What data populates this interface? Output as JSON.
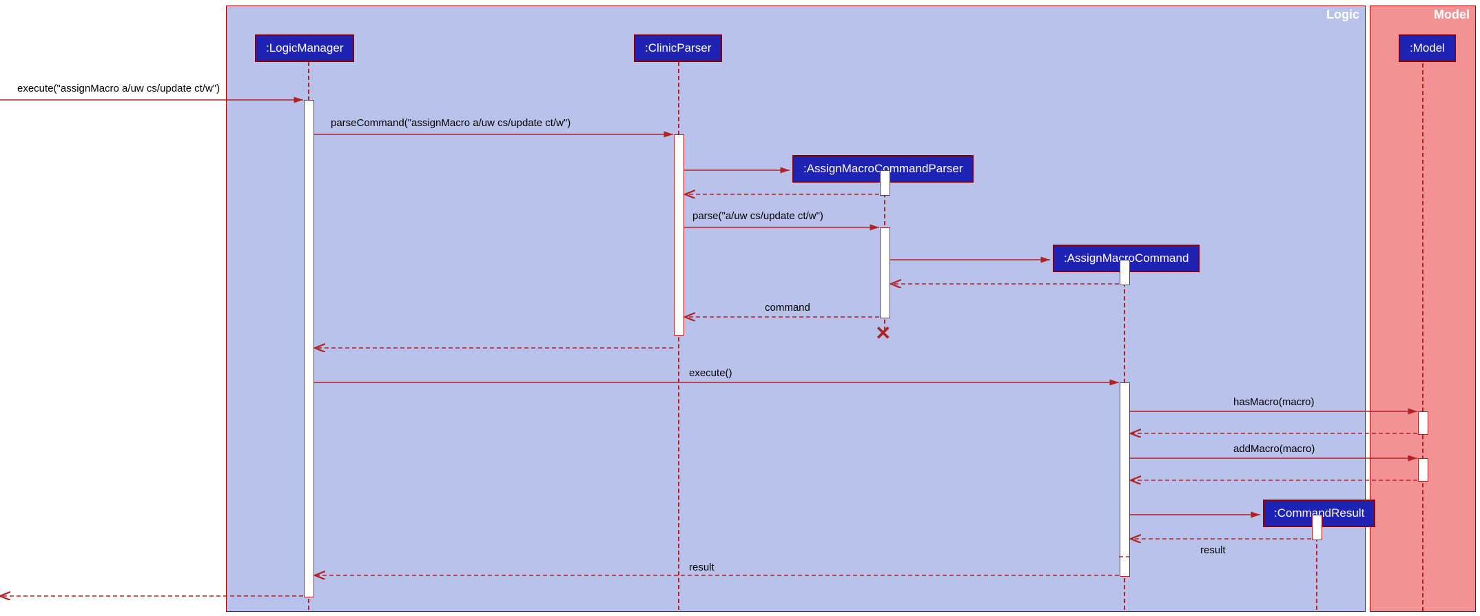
{
  "frames": {
    "logic": "Logic",
    "model": "Model"
  },
  "participants": {
    "logicManager": ":LogicManager",
    "clinicParser": ":ClinicParser",
    "assignParser": ":AssignMacroCommandParser",
    "assignCmd": ":AssignMacroCommand",
    "cmdResult": ":CommandResult",
    "model": ":Model"
  },
  "messages": {
    "m1": "execute(\"assignMacro a/uw cs/update ct/w\")",
    "m2": "parseCommand(\"assignMacro a/uw cs/update ct/w\")",
    "m3": "parse(\"a/uw cs/update ct/w\")",
    "m4": "command",
    "m5": "execute()",
    "m6": "hasMacro(macro)",
    "m7": "addMacro(macro)",
    "m8": "result",
    "m9": "result"
  }
}
